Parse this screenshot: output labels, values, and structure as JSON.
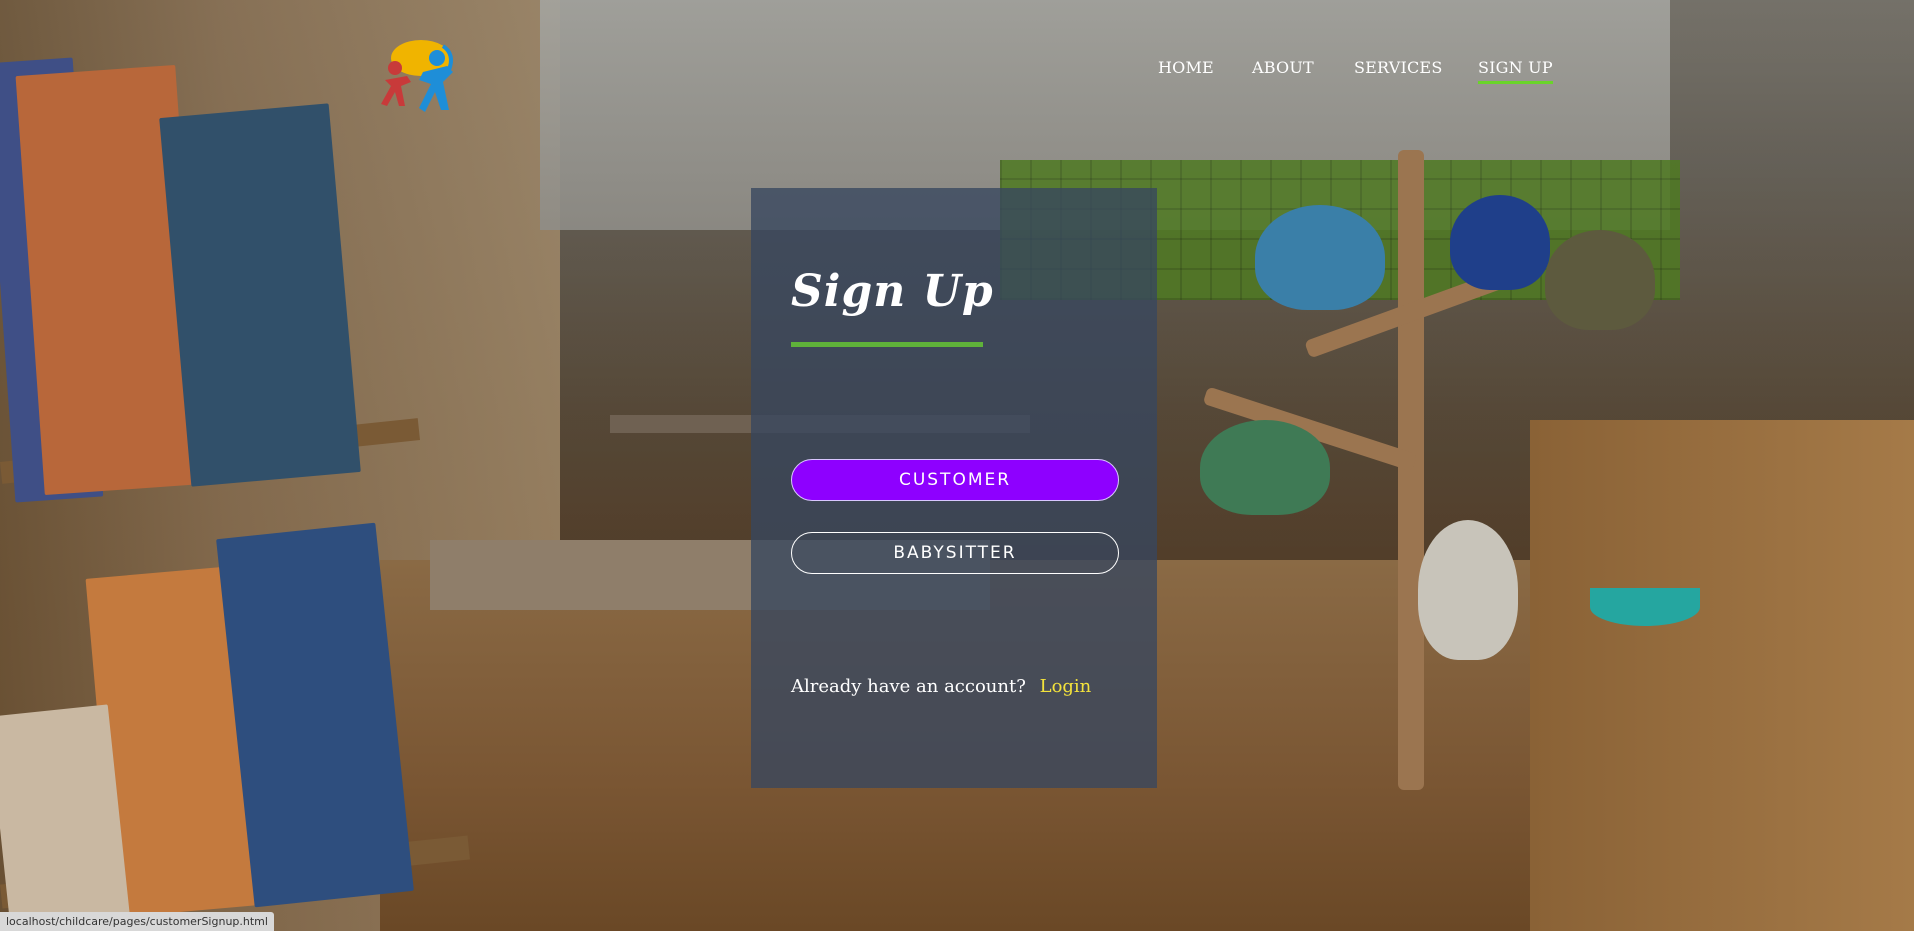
{
  "nav": {
    "items": [
      {
        "label": "HOME",
        "active": false
      },
      {
        "label": "ABOUT",
        "active": false
      },
      {
        "label": "SERVICES",
        "active": false
      },
      {
        "label": "SIGN UP",
        "active": true
      }
    ]
  },
  "panel": {
    "title": "Sign Up",
    "customer_button": "CUSTOMER",
    "babysitter_button": "BABYSITTER",
    "account_prompt": "Already have an account?",
    "login_link": "Login"
  },
  "status_bar": {
    "url": "localhost/childcare/pages/customerSignup.html"
  },
  "colors": {
    "accent_purple": "#8e00ff",
    "accent_green": "#5fb23a",
    "login_yellow": "#f3e23c",
    "panel_bg": "#37465f"
  }
}
